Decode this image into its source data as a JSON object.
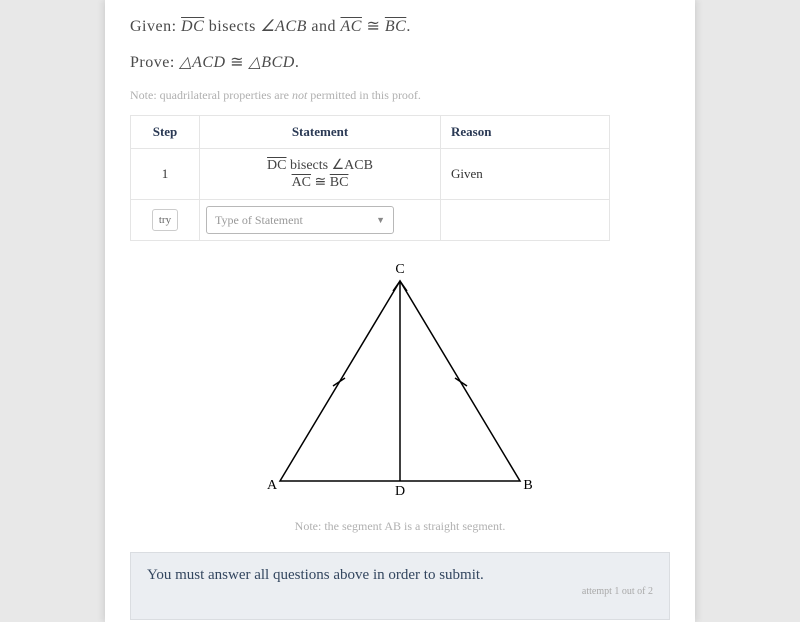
{
  "given_prefix": "Given: ",
  "given_math": "DC bisects ∠ACB and AC ≅ BC.",
  "prove_prefix": "Prove: ",
  "prove_math": "△ACD ≅ △BCD.",
  "note_top_a": "Note: quadrilateral properties are ",
  "note_top_b": "not",
  "note_top_c": " permitted in this proof.",
  "table": {
    "headers": {
      "step": "Step",
      "statement": "Statement",
      "reason": "Reason"
    },
    "rows": [
      {
        "step": "1",
        "stmt_line1": "DC bisects ∠ACB",
        "stmt_line2": "AC ≅ BC",
        "reason": "Given"
      }
    ],
    "try_label": "try",
    "type_placeholder": "Type of Statement"
  },
  "figure": {
    "labels": {
      "A": "A",
      "B": "B",
      "C": "C",
      "D": "D"
    },
    "note_a": "Note: the segment ",
    "note_b": "AB",
    "note_c": " is a straight segment."
  },
  "submit_msg": "You must answer all questions above in order to submit.",
  "attempt_text": "attempt 1 out of 2"
}
